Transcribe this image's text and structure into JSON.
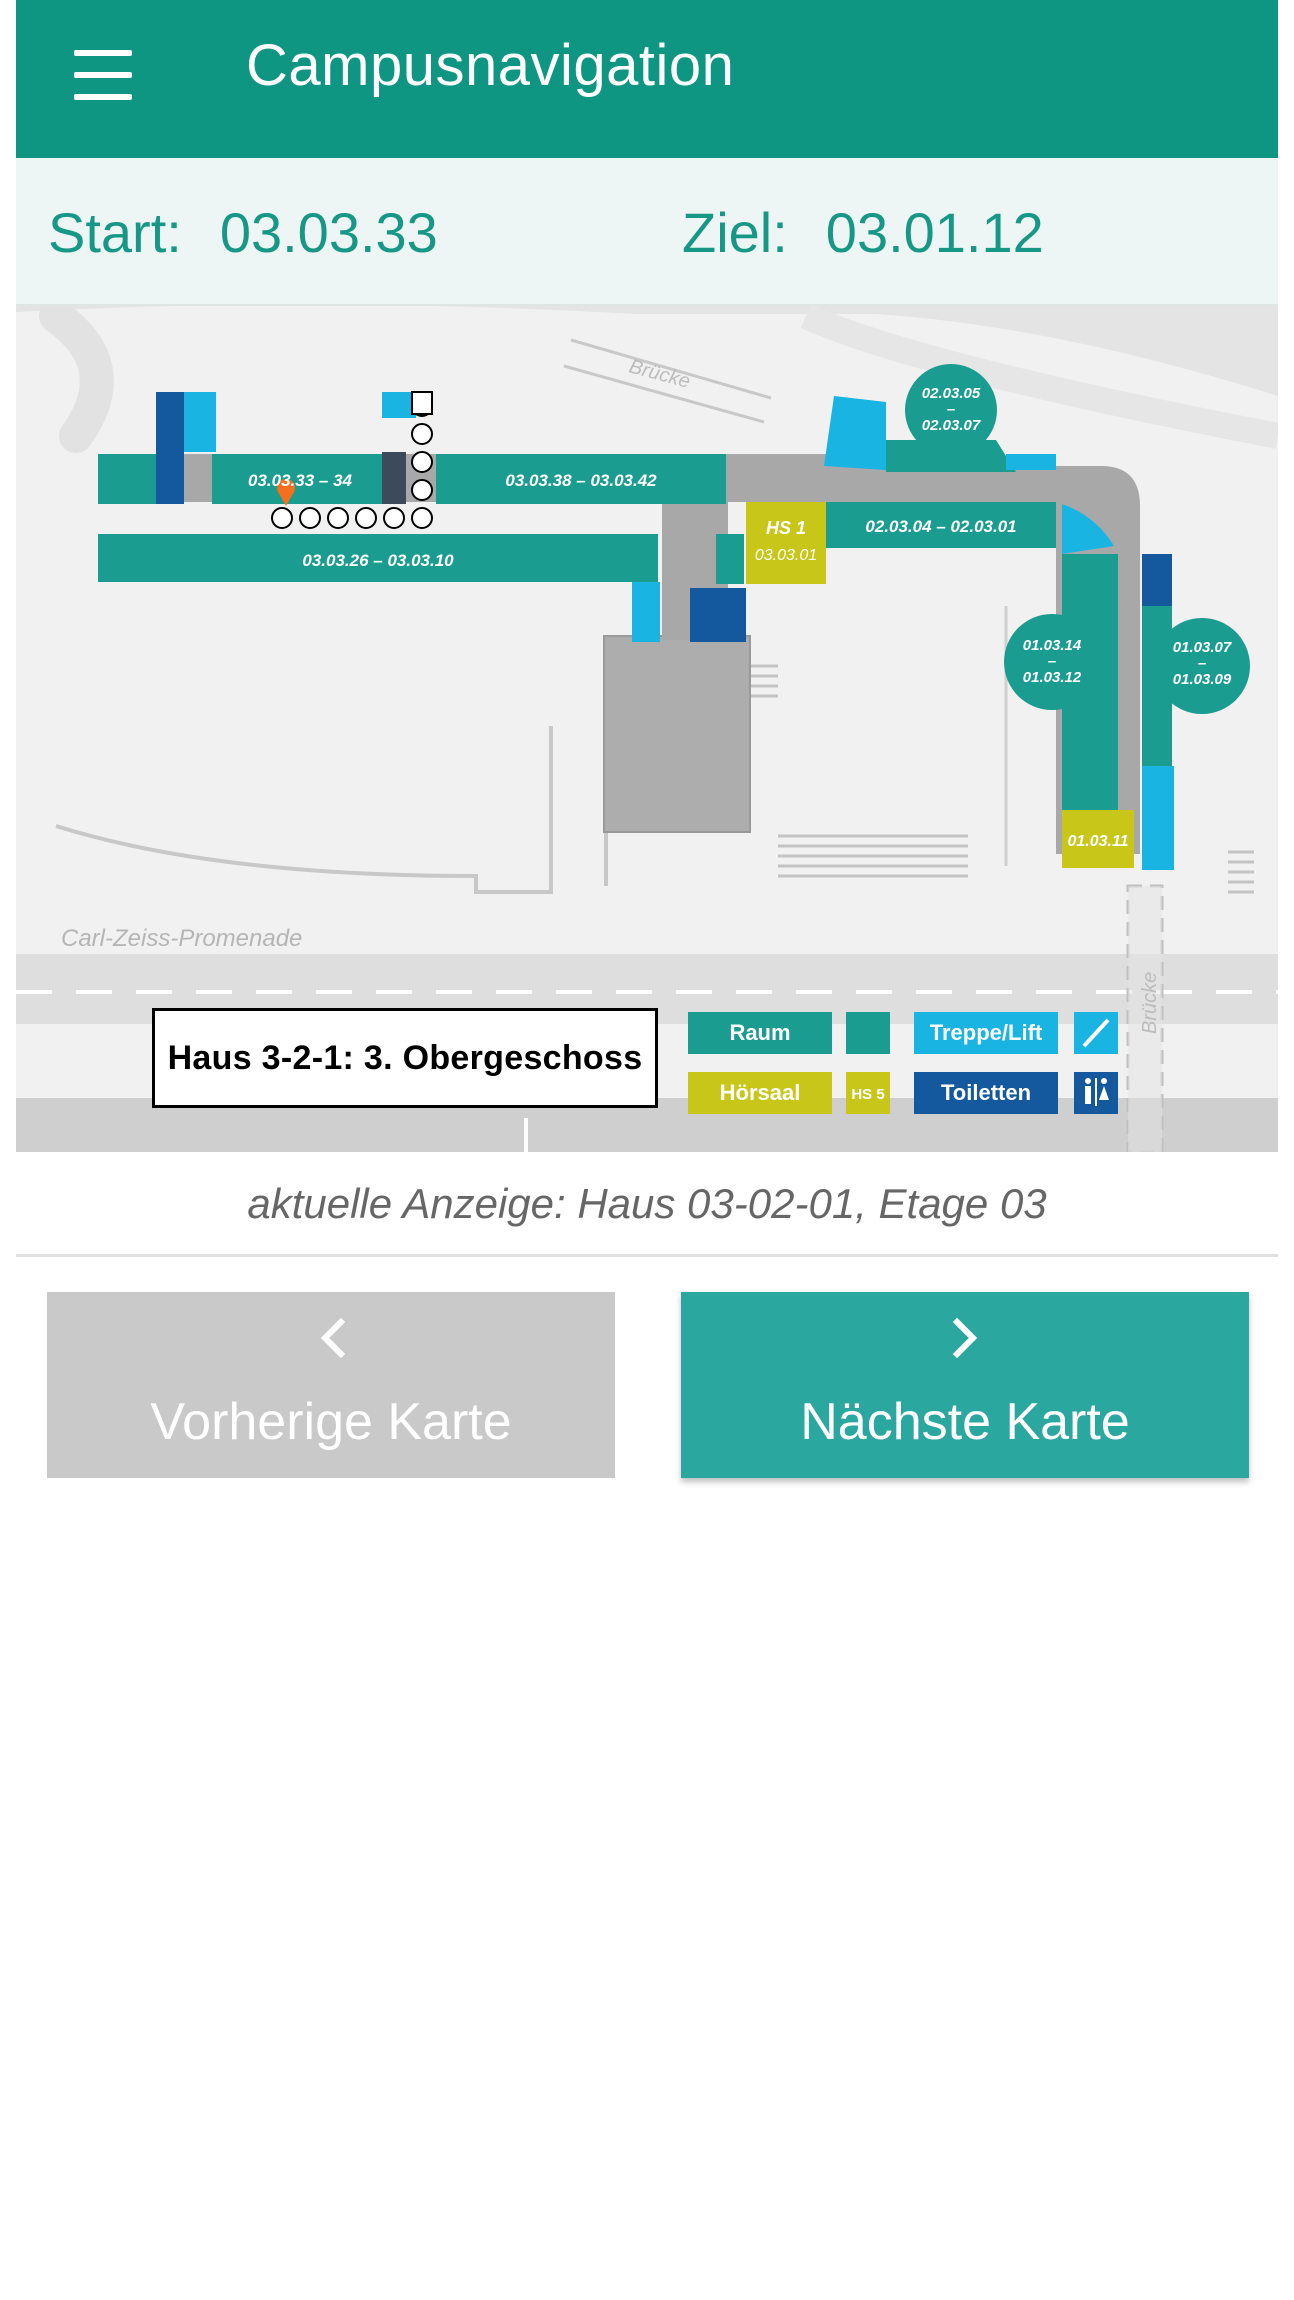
{
  "app": {
    "title": "Campusnavigation"
  },
  "route": {
    "start_label": "Start:",
    "start_value": "03.03.33",
    "destination_label": "Ziel:",
    "destination_value": "03.01.12"
  },
  "map": {
    "street_label": "Carl-Zeiss-Promenade",
    "bridge_label": "Brücke",
    "floor_label": "Haus 3-2-1:  3. Obergeschoss",
    "rooms": {
      "r1": "03.03.33 – 34",
      "r2": "03.03.38  –  03.03.42",
      "r3": "03.03.26  –  03.03.10",
      "r4": "02.03.04  –  02.03.01",
      "hs1_name": "HS 1",
      "hs1_room": "03.03.01",
      "c1_top": "02.03.05",
      "c1_bottom": "02.03.07",
      "c2_top": "01.03.14",
      "c2_bottom": "01.03.12",
      "c3_top": "01.03.07",
      "c3_bottom": "01.03.09",
      "r5": "01.03.11",
      "dash": "–"
    },
    "legend": {
      "room": "Raum",
      "stairs_lift": "Treppe/Lift",
      "lecture_hall": "Hörsaal",
      "lecture_hall_sample": "HS 5",
      "toilets": "Toiletten"
    },
    "colors": {
      "room": "#1a9c91",
      "lecture_hall": "#c9c61a",
      "stairs": "#1ab4e2",
      "toilets": "#14589d",
      "corridor": "#a8a8a8",
      "marker": "#f2701e"
    }
  },
  "caption": "aktuelle Anzeige: Haus 03-02-01, Etage 03",
  "nav": {
    "prev_label": "Vorherige Karte",
    "next_label": "Nächste Karte"
  },
  "colors": {
    "appbar": "#0f9682",
    "accent_text": "#179786",
    "next_button": "#2aa79e",
    "prev_button_disabled": "#c9c9c9"
  }
}
